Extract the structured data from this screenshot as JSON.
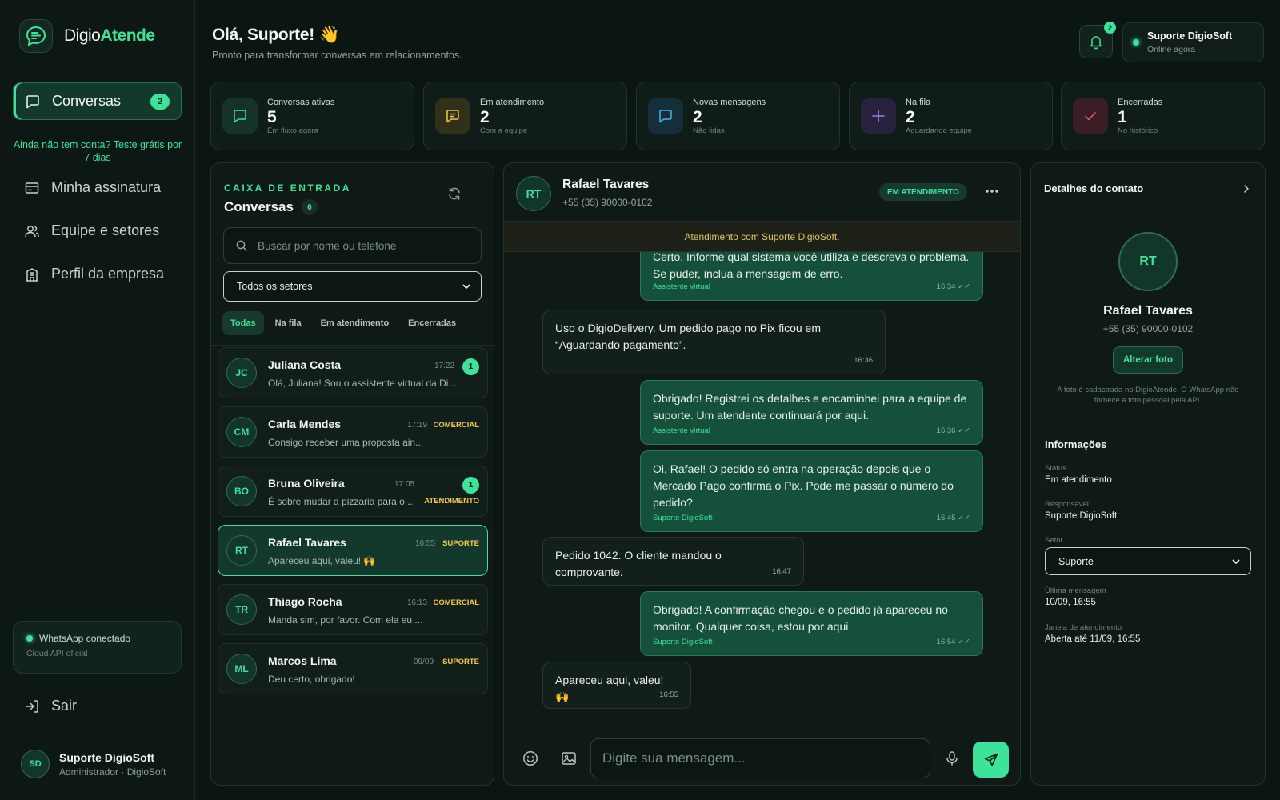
{
  "brand": {
    "part1": "Digio",
    "part2": "Atende"
  },
  "sidebar": {
    "active": {
      "label": "Conversas",
      "badge": "2"
    },
    "trial": "Ainda não tem conta? Teste grátis por 7 dias",
    "items": [
      {
        "label": "Minha assinatura",
        "icon": "card-icon"
      },
      {
        "label": "Equipe e setores",
        "icon": "users-icon"
      },
      {
        "label": "Perfil da empresa",
        "icon": "building-icon"
      }
    ],
    "whatsapp": {
      "title": "WhatsApp conectado",
      "sub": "Cloud API oficial"
    },
    "logout": "Sair",
    "user": {
      "initials": "SD",
      "name": "Suporte DigioSoft",
      "role": "Administrador · DigioSoft"
    }
  },
  "header": {
    "greeting": "Olá, Suporte! 👋",
    "subtitle": "Pronto para transformar conversas em relacionamentos.",
    "notifications": "2",
    "user": {
      "name": "Suporte DigioSoft",
      "status": "Online agora"
    }
  },
  "stats": [
    {
      "label": "Conversas ativas",
      "value": "5",
      "sub": "Em fluxo agora",
      "color": "#3ee39a"
    },
    {
      "label": "Em atendimento",
      "value": "2",
      "sub": "Com a equipe",
      "color": "#f2c94c"
    },
    {
      "label": "Novas mensagens",
      "value": "2",
      "sub": "Não lidas",
      "color": "#4fb3e8"
    },
    {
      "label": "Na fila",
      "value": "2",
      "sub": "Aguardando equipe",
      "color": "#9b7cf0"
    },
    {
      "label": "Encerradas",
      "value": "1",
      "sub": "No histórico",
      "color": "#e8546a"
    }
  ],
  "inbox": {
    "kicker": "CAIXA DE ENTRADA",
    "title": "Conversas",
    "count": "6",
    "search_placeholder": "Buscar por nome ou telefone",
    "sector_select": "Todos os setores",
    "filters": [
      "Todas",
      "Na fila",
      "Em atendimento",
      "Encerradas"
    ],
    "conversations": [
      {
        "initials": "JC",
        "name": "Juliana Costa",
        "time": "17:22",
        "preview": "Olá, Juliana! Sou o assistente virtual da Di...",
        "tag": "",
        "badge": "1"
      },
      {
        "initials": "CM",
        "name": "Carla Mendes",
        "time": "17:19",
        "preview": "Consigo receber uma proposta ain...",
        "tag": "COMERCIAL",
        "badge": ""
      },
      {
        "initials": "BO",
        "name": "Bruna Oliveira",
        "time": "17:05",
        "preview": "É sobre mudar a pizzaria para o ...",
        "tag": "ATENDIMENTO",
        "badge": "1"
      },
      {
        "initials": "RT",
        "name": "Rafael Tavares",
        "time": "16:55",
        "preview": "Apareceu aqui, valeu! 🙌",
        "tag": "SUPORTE",
        "badge": ""
      },
      {
        "initials": "TR",
        "name": "Thiago Rocha",
        "time": "16:13",
        "preview": "Manda sim, por favor. Com ela eu ...",
        "tag": "COMERCIAL",
        "badge": ""
      },
      {
        "initials": "ML",
        "name": "Marcos Lima",
        "time": "09/09",
        "preview": "Deu certo, obrigado!",
        "tag": "SUPORTE",
        "badge": ""
      }
    ]
  },
  "chat": {
    "initials": "RT",
    "name": "Rafael Tavares",
    "phone": "+55 (35) 90000-0102",
    "status": "EM ATENDIMENTO",
    "banner": "Atendimento com Suporte DigioSoft.",
    "messages": [
      {
        "dir": "out",
        "text": "Certo. Informe qual sistema você utiliza e descreva o problema. Se puder, inclua a mensagem de erro.",
        "sender": "Assistente virtual",
        "time": "16:34 ✓✓"
      },
      {
        "dir": "in",
        "text": "Uso o DigioDelivery. Um pedido pago no Pix ficou em “Aguardando pagamento”.",
        "sender": "",
        "time": "16:36"
      },
      {
        "dir": "out",
        "text": "Obrigado! Registrei os detalhes e encaminhei para a equipe de suporte. Um atendente continuará por aqui.",
        "sender": "Assistente virtual",
        "time": "16:36 ✓✓"
      },
      {
        "dir": "out",
        "text": "Oi, Rafael! O pedido só entra na operação depois que o Mercado Pago confirma o Pix. Pode me passar o número do pedido?",
        "sender": "Suporte DigioSoft",
        "time": "16:45 ✓✓"
      },
      {
        "dir": "in",
        "text": "Pedido 1042. O cliente mandou o comprovante.",
        "sender": "",
        "time": "16:47"
      },
      {
        "dir": "out",
        "text": "Obrigado! A confirmação chegou e o pedido já apareceu no monitor. Qualquer coisa, estou por aqui.",
        "sender": "Suporte DigioSoft",
        "time": "16:54 ✓✓"
      },
      {
        "dir": "in",
        "text": "Apareceu aqui, valeu! 🙌",
        "sender": "",
        "time": "16:55"
      }
    ],
    "compose_placeholder": "Digite sua mensagem..."
  },
  "details": {
    "title": "Detalhes do contato",
    "initials": "RT",
    "name": "Rafael Tavares",
    "phone": "+55 (35) 90000-0102",
    "change_photo": "Alterar foto",
    "note": "A foto é cadastrada no DigioAtende. O WhatsApp não fornece a foto pessoal pela API.",
    "section": "Informações",
    "fields": [
      {
        "label": "Status",
        "value": "Em atendimento"
      },
      {
        "label": "Responsável",
        "value": "Suporte DigioSoft"
      },
      {
        "label": "Setor",
        "value": "Suporte"
      },
      {
        "label": "Última mensagem",
        "value": "10/09, 16:55"
      },
      {
        "label": "Janela de atendimento",
        "value": "Aberta até 11/09, 16:55"
      }
    ]
  }
}
